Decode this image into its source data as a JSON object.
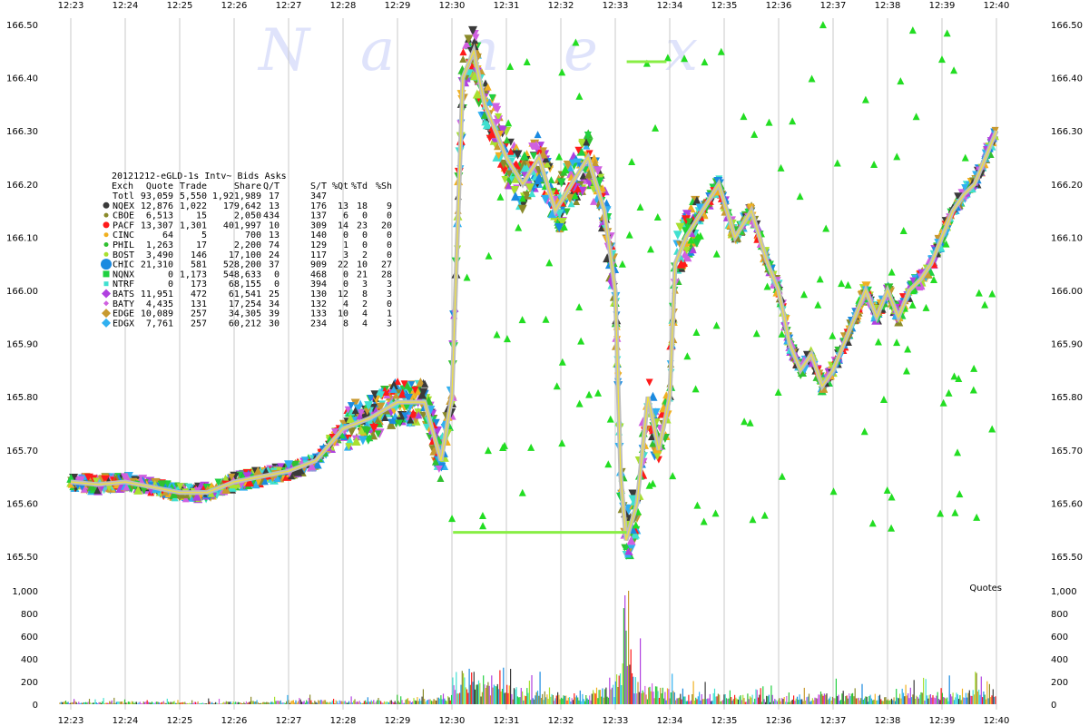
{
  "chart_data": {
    "type": "scatter",
    "title": "20121212-eGLD-1s Intv~ Bids  Asks",
    "watermark": "Nanex",
    "x_ticks": [
      "12:23",
      "12:24",
      "12:25",
      "12:26",
      "12:27",
      "12:28",
      "12:29",
      "12:30",
      "12:31",
      "12:32",
      "12:33",
      "12:34",
      "12:35",
      "12:36",
      "12:37",
      "12:38",
      "12:39",
      "12:40"
    ],
    "xlim_minutes": [
      12.23,
      12.4
    ],
    "price_ticks": [
      "166.50",
      "166.40",
      "166.30",
      "166.20",
      "166.10",
      "166.00",
      "165.90",
      "165.80",
      "165.70",
      "165.60",
      "165.50"
    ],
    "ylim_price": [
      165.45,
      166.5
    ],
    "volume_ticks": [
      "1,000",
      "800",
      "600",
      "400",
      "200",
      "0"
    ],
    "ylim_volume": [
      0,
      1000
    ],
    "volume_label": "Quotes",
    "grid": true,
    "legend_placement": "upper-left",
    "legend_header": [
      "Exch",
      "Quote",
      "Trade",
      "Share",
      "Q/T",
      "S/T",
      "%Qt",
      "%Td",
      "%Sh"
    ],
    "legend_rows": [
      {
        "exch": "Totl",
        "quote": "93,059",
        "trade": "5,550",
        "share": "1,921,989",
        "qt": "17",
        "st": "347",
        "pqt": "",
        "ptd": "",
        "psh": "",
        "color": "",
        "marker": "none"
      },
      {
        "exch": "NQEX",
        "quote": "12,876",
        "trade": "1,022",
        "share": "179,642",
        "qt": "13",
        "st": "176",
        "pqt": "13",
        "ptd": "18",
        "psh": "9",
        "color": "#3a3a3a",
        "marker": "circle"
      },
      {
        "exch": "CBOE",
        "quote": "6,513",
        "trade": "15",
        "share": "2,050",
        "qt": "434",
        "st": "137",
        "pqt": "6",
        "ptd": "0",
        "psh": "0",
        "color": "#8a8a2a",
        "marker": "circle-small"
      },
      {
        "exch": "PACF",
        "quote": "13,307",
        "trade": "1,301",
        "share": "401,997",
        "qt": "10",
        "st": "309",
        "pqt": "14",
        "ptd": "23",
        "psh": "20",
        "color": "#ff1a1a",
        "marker": "circle"
      },
      {
        "exch": "CINC",
        "quote": "64",
        "trade": "5",
        "share": "700",
        "qt": "13",
        "st": "140",
        "pqt": "0",
        "ptd": "0",
        "psh": "0",
        "color": "#f0b020",
        "marker": "circle-small"
      },
      {
        "exch": "PHIL",
        "quote": "1,263",
        "trade": "17",
        "share": "2,200",
        "qt": "74",
        "st": "129",
        "pqt": "1",
        "ptd": "0",
        "psh": "0",
        "color": "#30c030",
        "marker": "circle-small"
      },
      {
        "exch": "BOST",
        "quote": "3,490",
        "trade": "146",
        "share": "17,100",
        "qt": "24",
        "st": "117",
        "pqt": "3",
        "ptd": "2",
        "psh": "0",
        "color": "#a8e030",
        "marker": "circle-small"
      },
      {
        "exch": "CHIC",
        "quote": "21,310",
        "trade": "581",
        "share": "528,200",
        "qt": "37",
        "st": "909",
        "pqt": "22",
        "ptd": "10",
        "psh": "27",
        "color": "#1a8ae0",
        "marker": "circle-big"
      },
      {
        "exch": "NQNX",
        "quote": "0",
        "trade": "1,173",
        "share": "548,633",
        "qt": "0",
        "st": "468",
        "pqt": "0",
        "ptd": "21",
        "psh": "28",
        "color": "#20d040",
        "marker": "square"
      },
      {
        "exch": "NTRF",
        "quote": "0",
        "trade": "173",
        "share": "68,155",
        "qt": "0",
        "st": "394",
        "pqt": "0",
        "ptd": "3",
        "psh": "3",
        "color": "#40e0d0",
        "marker": "square-small"
      },
      {
        "exch": "BATS",
        "quote": "11,951",
        "trade": "472",
        "share": "61,541",
        "qt": "25",
        "st": "130",
        "pqt": "12",
        "ptd": "8",
        "psh": "3",
        "color": "#b040e0",
        "marker": "diamond"
      },
      {
        "exch": "BATY",
        "quote": "4,435",
        "trade": "131",
        "share": "17,254",
        "qt": "34",
        "st": "132",
        "pqt": "4",
        "ptd": "2",
        "psh": "0",
        "color": "#d060e0",
        "marker": "diamond-small"
      },
      {
        "exch": "EDGE",
        "quote": "10,089",
        "trade": "257",
        "share": "34,305",
        "qt": "39",
        "st": "133",
        "pqt": "10",
        "ptd": "4",
        "psh": "1",
        "color": "#c89a30",
        "marker": "diamond"
      },
      {
        "exch": "EDGX",
        "quote": "7,761",
        "trade": "257",
        "share": "60,212",
        "qt": "30",
        "st": "234",
        "pqt": "8",
        "ptd": "4",
        "psh": "3",
        "color": "#30b0f0",
        "marker": "diamond"
      }
    ],
    "series": [
      {
        "name": "price_path",
        "points": [
          [
            12.23,
            165.64
          ],
          [
            12.235,
            165.635
          ],
          [
            12.24,
            165.64
          ],
          [
            12.245,
            165.63
          ],
          [
            12.25,
            165.62
          ],
          [
            12.255,
            165.62
          ],
          [
            12.26,
            165.64
          ],
          [
            12.265,
            165.65
          ],
          [
            12.27,
            165.66
          ],
          [
            12.275,
            165.68
          ],
          [
            12.28,
            165.74
          ],
          [
            12.285,
            165.76
          ],
          [
            12.29,
            165.79
          ],
          [
            12.295,
            165.79
          ],
          [
            12.298,
            165.68
          ],
          [
            12.3,
            165.8
          ],
          [
            12.302,
            166.4
          ],
          [
            12.304,
            166.45
          ],
          [
            12.306,
            166.35
          ],
          [
            12.308,
            166.3
          ],
          [
            12.31,
            166.25
          ],
          [
            12.313,
            166.2
          ],
          [
            12.316,
            166.25
          ],
          [
            12.319,
            166.15
          ],
          [
            12.322,
            166.2
          ],
          [
            12.325,
            166.25
          ],
          [
            12.328,
            166.15
          ],
          [
            12.33,
            166.0
          ],
          [
            12.331,
            165.65
          ],
          [
            12.332,
            165.53
          ],
          [
            12.334,
            165.6
          ],
          [
            12.336,
            165.8
          ],
          [
            12.338,
            165.7
          ],
          [
            12.34,
            165.8
          ],
          [
            12.341,
            166.05
          ],
          [
            12.343,
            166.1
          ],
          [
            12.346,
            166.15
          ],
          [
            12.349,
            166.2
          ],
          [
            12.352,
            166.1
          ],
          [
            12.355,
            166.15
          ],
          [
            12.358,
            166.05
          ],
          [
            12.36,
            166.0
          ],
          [
            12.362,
            165.9
          ],
          [
            12.364,
            165.85
          ],
          [
            12.366,
            165.88
          ],
          [
            12.368,
            165.82
          ],
          [
            12.37,
            165.85
          ],
          [
            12.372,
            165.9
          ],
          [
            12.374,
            165.95
          ],
          [
            12.376,
            166.0
          ],
          [
            12.378,
            165.95
          ],
          [
            12.38,
            166.0
          ],
          [
            12.382,
            165.95
          ],
          [
            12.384,
            166.0
          ],
          [
            12.386,
            166.02
          ],
          [
            12.388,
            166.05
          ],
          [
            12.39,
            166.1
          ],
          [
            12.392,
            166.15
          ],
          [
            12.394,
            166.18
          ],
          [
            12.396,
            166.2
          ],
          [
            12.398,
            166.25
          ],
          [
            12.4,
            166.3
          ]
        ]
      },
      {
        "name": "volume_path",
        "points": [
          [
            12.23,
            30
          ],
          [
            12.24,
            40
          ],
          [
            12.25,
            30
          ],
          [
            12.26,
            35
          ],
          [
            12.27,
            60
          ],
          [
            12.28,
            50
          ],
          [
            12.29,
            60
          ],
          [
            12.3,
            150
          ],
          [
            12.302,
            650
          ],
          [
            12.305,
            300
          ],
          [
            12.31,
            250
          ],
          [
            12.315,
            200
          ],
          [
            12.32,
            150
          ],
          [
            12.325,
            130
          ],
          [
            12.33,
            400
          ],
          [
            12.332,
            950
          ],
          [
            12.334,
            500
          ],
          [
            12.336,
            250
          ],
          [
            12.34,
            200
          ],
          [
            12.345,
            150
          ],
          [
            12.35,
            130
          ],
          [
            12.355,
            120
          ],
          [
            12.36,
            120
          ],
          [
            12.365,
            130
          ],
          [
            12.37,
            150
          ],
          [
            12.375,
            140
          ],
          [
            12.38,
            140
          ],
          [
            12.385,
            150
          ],
          [
            12.39,
            160
          ],
          [
            12.395,
            180
          ],
          [
            12.4,
            200
          ]
        ]
      }
    ]
  }
}
